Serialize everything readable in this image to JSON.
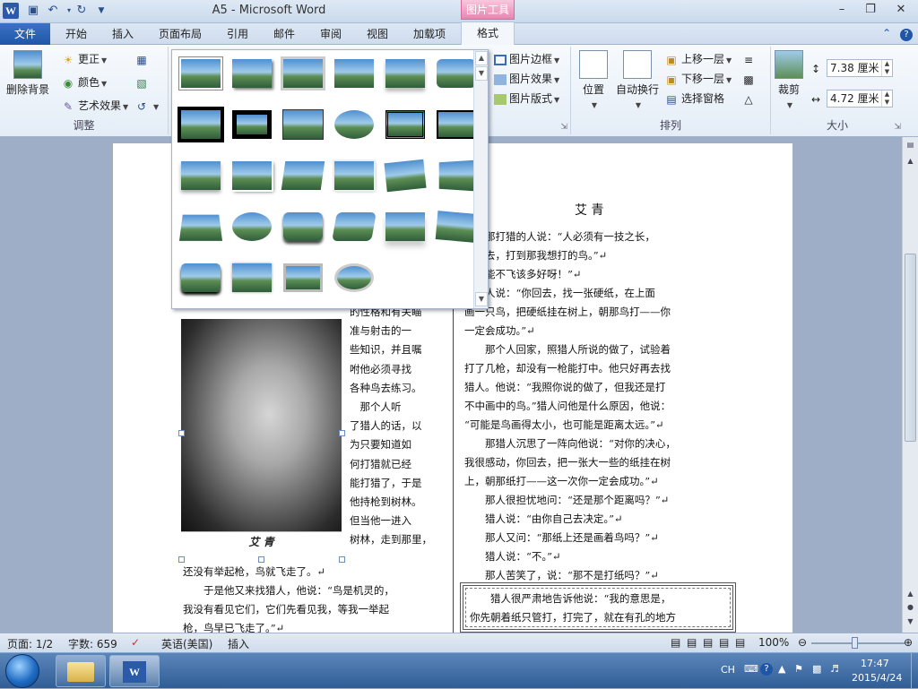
{
  "window": {
    "title": "A5 - Microsoft Word",
    "context_tab_group": "图片工具"
  },
  "tabs": {
    "file": "文件",
    "home": "开始",
    "insert": "插入",
    "layout": "页面布局",
    "references": "引用",
    "mailings": "邮件",
    "review": "审阅",
    "view": "视图",
    "addins": "加载项",
    "format": "格式"
  },
  "ribbon": {
    "adjust": {
      "remove_bg": "删除背景",
      "corrections": "更正",
      "color": "颜色",
      "artistic": "艺术效果",
      "label": "调整"
    },
    "styles": {
      "border": "图片边框",
      "effects": "图片效果",
      "layout": "图片版式"
    },
    "arrange": {
      "position": "位置",
      "wrap": "自动换行",
      "bring_forward": "上移一层",
      "send_backward": "下移一层",
      "selection_pane": "选择窗格",
      "label": "排列"
    },
    "size": {
      "crop": "裁剪",
      "height": "7.38 厘米",
      "width": "4.72 厘米",
      "label": "大小"
    }
  },
  "document": {
    "heading": "艾 青",
    "caption": "艾 青",
    "left_col": [
      "的性格和有关瞄",
      "准与射击的一",
      "些知识，并且嘱",
      "咐他必须寻找",
      "各种鸟去练习。",
      "　那个人听",
      "了猎人的话，以",
      "为只要知道如",
      "何打猎就已经",
      "能打猎了，于是",
      "他持枪到树林。",
      "但当他一进入",
      "树林，走到那里，"
    ],
    "left_full": [
      "还没有举起枪，鸟就飞走了。↵",
      "　　于是他又来找猎人，他说：“鸟是机灵的，",
      "我没有看见它们，它们先看见我，等我一举起",
      "枪，鸟早已飞走了。”↵"
    ],
    "right_col": [
      "他向那打猎的人说：“人必须有一技之长，",
      "你里去，打到那我想打的鸟。”↵",
      "是鸟能不飞该多好呀！”↵",
      "　猎人说：“你回去，找一张硬纸，在上面",
      "画一只鸟，把硬纸挂在树上，朝那鸟打——你",
      "一定会成功。”↵",
      "　　那个人回家，照猎人所说的做了，试验着",
      "打了几枪，却没有一枪能打中。他只好再去找",
      "猎人。他说：“我照你说的做了，但我还是打",
      "不中画中的鸟。”猎人问他是什么原因，他说：",
      "“可能是鸟画得太小，也可能是距离太远。”↵",
      "　　那猎人沉思了一阵向他说：“对你的决心，",
      "我很感动，你回去，把一张大一些的纸挂在树",
      "上，朝那纸打——这一次你一定会成功。”↵",
      "　　那人很担忧地问：“还是那个距离吗？”↵",
      "　　猎人说：“由你自己去决定。”↵",
      "　　那人又问：“那纸上还是画着鸟吗？”↵",
      "　　猎人说：“不。”↵",
      "　　那人苦笑了，说：“那不是打纸吗？”↵"
    ],
    "boxed": [
      "　　猎人很严肃地告诉他说：“我的意思是，",
      "你先朝着纸只管打，打完了，就在有孔的地方"
    ]
  },
  "status": {
    "page": "页面: 1/2",
    "words": "字数: 659",
    "language": "英语(美国)",
    "mode": "插入",
    "zoom": "100%"
  },
  "tray": {
    "ime": "CH",
    "time": "17:47",
    "date": "2015/4/24"
  },
  "colors": {
    "accent": "#1f56a8",
    "context": "#e985b1"
  }
}
